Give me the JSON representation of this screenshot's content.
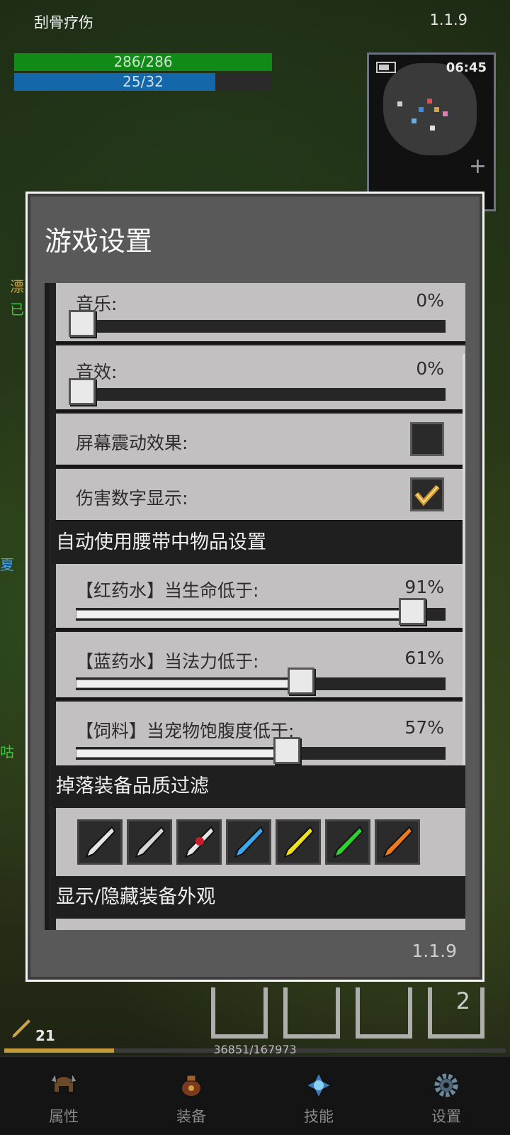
{
  "hud": {
    "title": "刮骨疗伤",
    "version": "1.1.9",
    "hp_text": "286/286",
    "hp_fraction": 1.0,
    "mp_text": "25/32",
    "mp_fraction": 0.78,
    "clock": "06:45"
  },
  "dialog": {
    "title": "游戏设置",
    "version": "1.1.9",
    "music_label": "音乐:",
    "music_value": "0%",
    "music_fraction": 0,
    "sfx_label": "音效:",
    "sfx_value": "0%",
    "sfx_fraction": 0,
    "shake_label": "屏幕震动效果:",
    "shake_checked": false,
    "damage_label": "伤害数字显示:",
    "damage_checked": true,
    "auto_section": "自动使用腰带中物品设置",
    "red_label": "【红药水】当生命低于:",
    "red_value": "91%",
    "red_fraction": 0.91,
    "blue_label": "【蓝药水】当法力低于:",
    "blue_value": "61%",
    "blue_fraction": 0.61,
    "feed_label": "【饲料】当宠物饱腹度低于:",
    "feed_value": "57%",
    "feed_fraction": 0.57,
    "drop_section": "掉落装备品质过滤",
    "quality_items": [
      {
        "icon": "white-feather-icon",
        "color": "#e6e6e6"
      },
      {
        "icon": "white-feather-icon",
        "color": "#d6d6d6"
      },
      {
        "icon": "red-gem-feather-icon",
        "color": "#e6e6e6"
      },
      {
        "icon": "blue-feather-icon",
        "color": "#3aa8f0"
      },
      {
        "icon": "yellow-feather-icon",
        "color": "#f2e020"
      },
      {
        "icon": "green-feather-icon",
        "color": "#2ad42a"
      },
      {
        "icon": "orange-feather-icon",
        "color": "#f07a1a"
      }
    ],
    "appearance_section": "显示/隐藏装备外观"
  },
  "bottom": {
    "level": "21",
    "exp_text": "36851/167973",
    "exp_fraction": 0.219,
    "slot_badge": "2",
    "nav": [
      {
        "label": "属性",
        "icon": "helmet-icon"
      },
      {
        "label": "装备",
        "icon": "bag-icon"
      },
      {
        "label": "技能",
        "icon": "skill-orb-icon"
      },
      {
        "label": "设置",
        "icon": "gear-icon"
      }
    ]
  }
}
